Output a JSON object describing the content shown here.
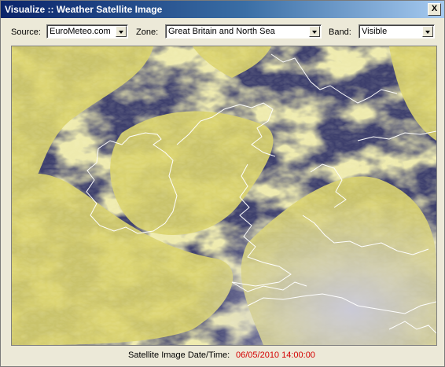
{
  "window": {
    "title": "Visualize :: Weather Satellite Image",
    "close_label": "X"
  },
  "controls": {
    "source_label": "Source:",
    "source_value": "EuroMeteo.com",
    "zone_label": "Zone:",
    "zone_value": "Great Britain and North Sea",
    "band_label": "Band:",
    "band_value": "Visible"
  },
  "status": {
    "date_label": "Satellite Image Date/Time:",
    "date_value": "06/05/2010 14:00:00"
  },
  "colors": {
    "cloud": "#d9d26a",
    "sea": "#3b3d6b",
    "coast": "#ffffff",
    "datetime": "#d40000"
  }
}
